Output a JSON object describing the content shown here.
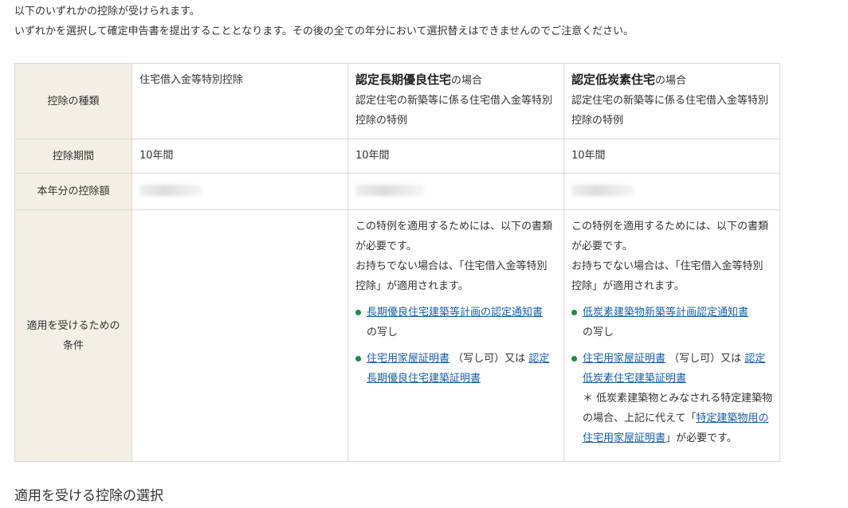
{
  "intro": {
    "line1": "以下のいずれかの控除が受けられます。",
    "line2": "いずれかを選択して確定申告書を提出することとなります。その後の全ての年分において選択替えはできませんのでご注意ください。"
  },
  "table": {
    "row_headers": {
      "type": "控除の種類",
      "period": "控除期間",
      "amount": "本年分の控除額",
      "conditions_line1": "適用を受けるための",
      "conditions_line2": "条件"
    },
    "col1": {
      "title": "住宅借入金等特別控除",
      "period": "10年間"
    },
    "col2": {
      "title_bold": "認定長期優良住宅",
      "title_suffix": "の場合",
      "subtitle": "認定住宅の新築等に係る住宅借入金等特別控除の特例",
      "period": "10年間",
      "cond_text1": "この特例を適用するためには、以下の書類が必要です。",
      "cond_text2": "お持ちでない場合は、「住宅借入金等特別控除」が適用されます。",
      "doc1_link": "長期優良住宅建築等計画の認定通知書",
      "doc1_suffix": "の写し",
      "doc2_link": "住宅用家屋証明書",
      "doc2_mid": "（写し可）又は",
      "doc2_link2": "認定長期優良住宅建築証明書"
    },
    "col3": {
      "title_bold": "認定低炭素住宅",
      "title_suffix": "の場合",
      "subtitle": "認定住宅の新築等に係る住宅借入金等特別控除の特例",
      "period": "10年間",
      "cond_text1": "この特例を適用するためには、以下の書類が必要です。",
      "cond_text2": "お持ちでない場合は、「住宅借入金等特別控除」が適用されます。",
      "doc1_link": "低炭素建築物新築等計画認定通知書",
      "doc1_suffix": "の写し",
      "doc2_link": "住宅用家屋証明書",
      "doc2_mid": "（写し可）又は",
      "doc2_link2": "認定低炭素住宅建築証明書",
      "note_prefix": "＊ 低炭素建築物とみなされる特定建築物の場合、上記に代えて「",
      "note_link": "特定建築物用の住宅用家屋証明書",
      "note_suffix": "」が必要です。"
    }
  },
  "section_title": "適用を受ける控除の選択",
  "colors": {
    "header_bg": "#f1efe6",
    "border": "#d9d9d9",
    "link": "#1a5fa8",
    "bullet": "#1e8a4a"
  }
}
